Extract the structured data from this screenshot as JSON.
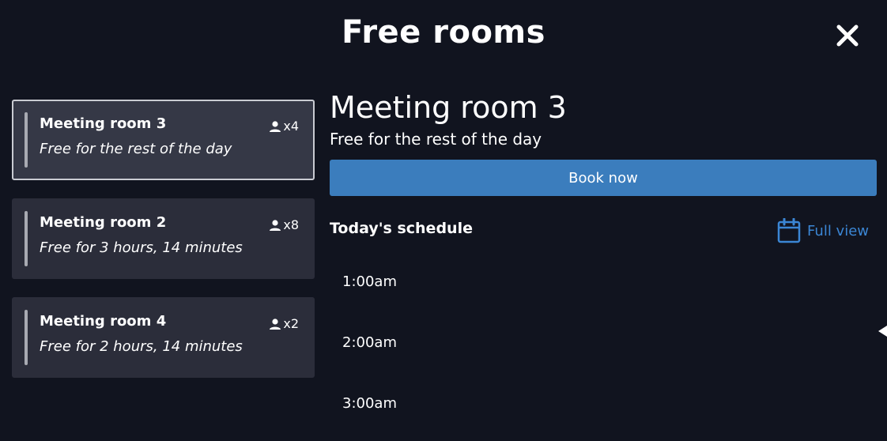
{
  "header": {
    "title": "Free rooms",
    "close_icon": "close-icon"
  },
  "rooms": [
    {
      "name": "Meeting room 3",
      "status": "Free for the rest of the day",
      "capacity": "x4",
      "selected": true
    },
    {
      "name": "Meeting room 2",
      "status": "Free for 3 hours, 14 minutes",
      "capacity": "x8",
      "selected": false
    },
    {
      "name": "Meeting room 4",
      "status": "Free for 2 hours, 14 minutes",
      "capacity": "x2",
      "selected": false
    }
  ],
  "detail": {
    "room_title": "Meeting room 3",
    "room_status": "Free for the rest of the day",
    "book_label": "Book now",
    "schedule_title": "Today's schedule",
    "full_view_label": "Full view",
    "full_view_icon": "calendar-icon",
    "time_slots": [
      "1:00am",
      "2:00am",
      "3:00am"
    ]
  },
  "colors": {
    "background": "#11141f",
    "card": "#2b2d3a",
    "card_selected": "#353846",
    "accent_blue": "#3b7dbd",
    "link_blue": "#3b86d4"
  }
}
